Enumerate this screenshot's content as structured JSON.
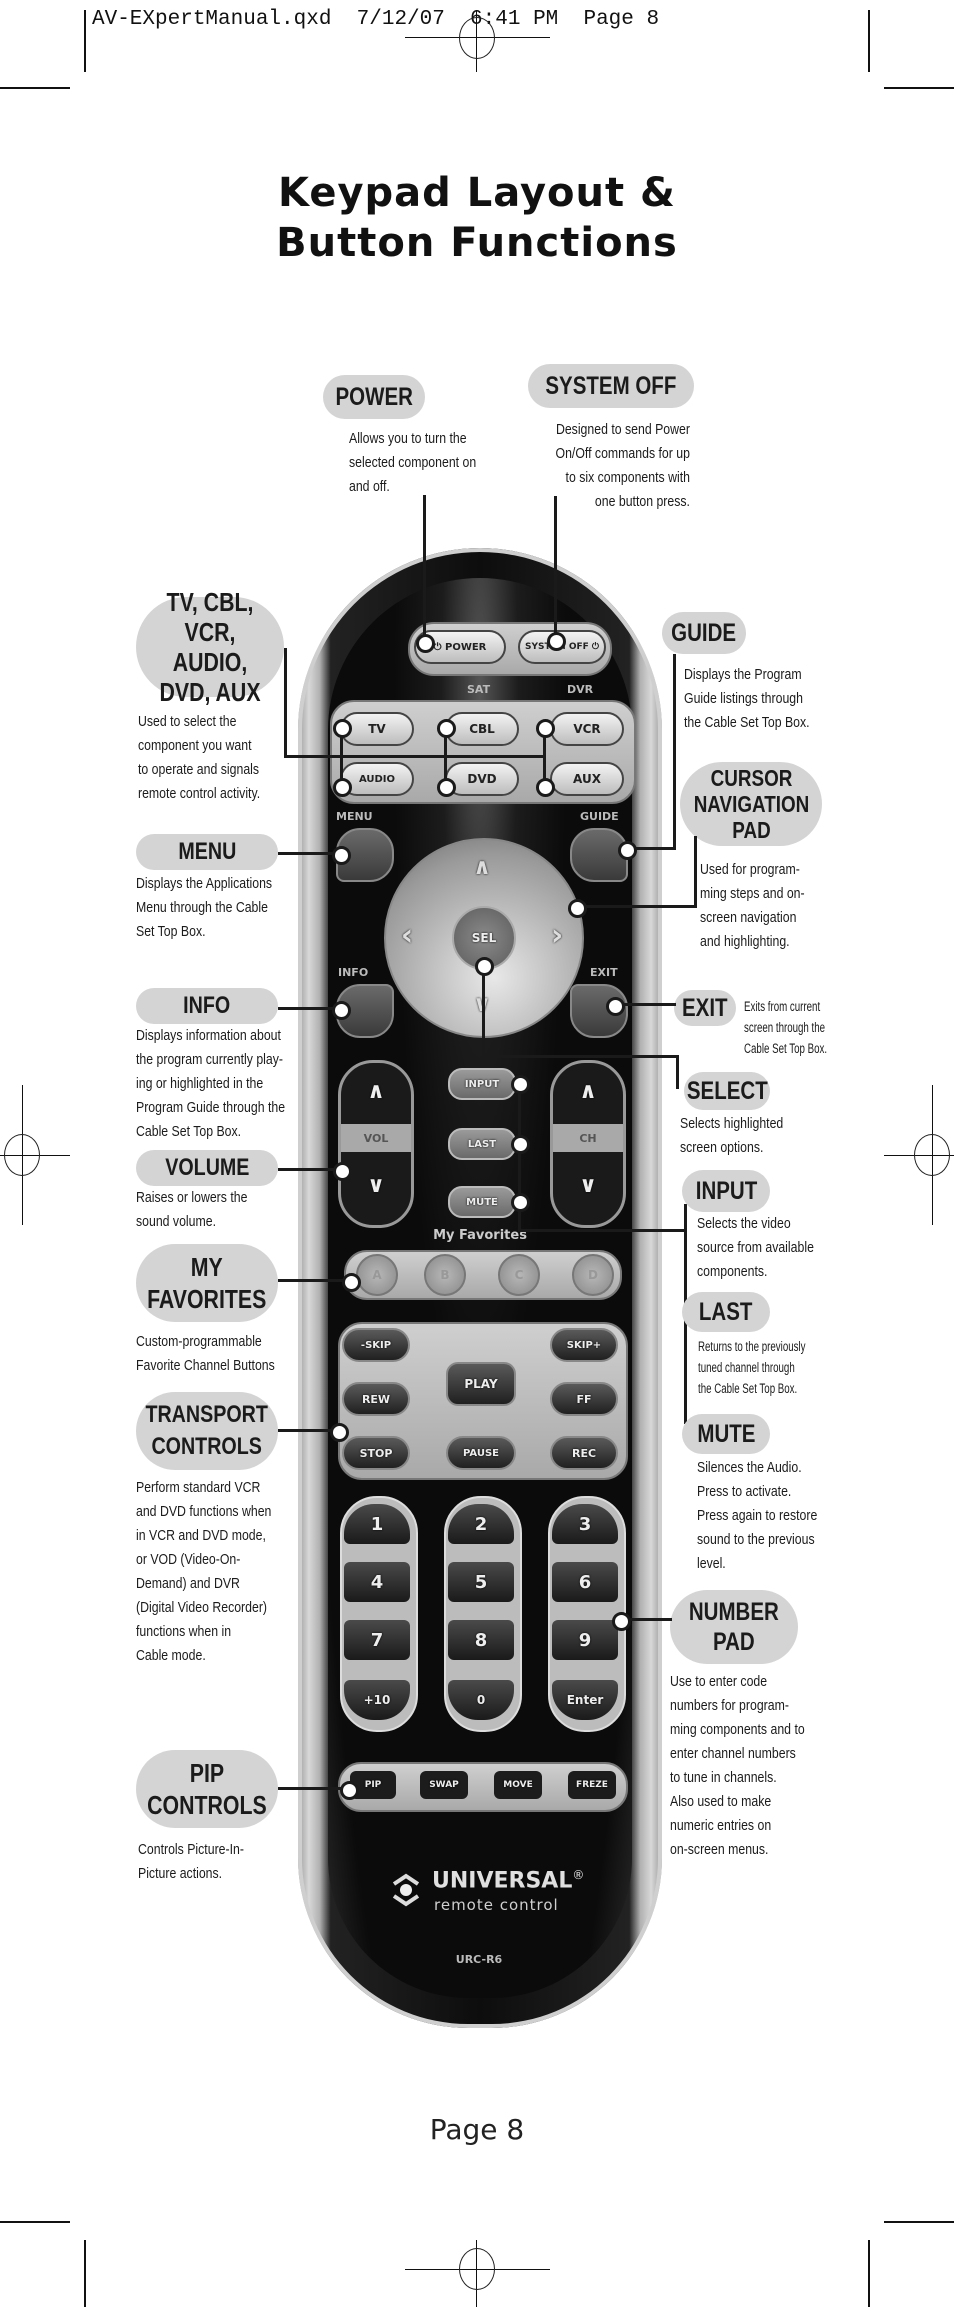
{
  "slug": "AV-EXpertManual.qxd  7/12/07  6:41 PM  Page 8",
  "title": {
    "line1": "Keypad Layout &",
    "line2": "Button Functions"
  },
  "callouts": {
    "power": {
      "label": "POWER",
      "desc": "Allows you to turn the\nselected component on\nand off."
    },
    "system_off": {
      "label": "SYSTEM OFF",
      "desc": "Designed to send Power\nOn/Off commands for up\nto six components with\none button press."
    },
    "modes": {
      "label": "TV, CBL,\nVCR, AUDIO,\nDVD, AUX",
      "desc": "Used to select the\ncomponent you want\nto operate and signals\nremote control activity."
    },
    "guide": {
      "label": "GUIDE",
      "desc": "Displays the Program\nGuide listings through\nthe Cable Set Top Box."
    },
    "cursor": {
      "label": "CURSOR\nNAVIGATION\nPAD",
      "desc": "Used for program-\nming steps and on-\nscreen navigation\nand highlighting."
    },
    "menu": {
      "label": "MENU",
      "desc": "Displays the Applications\nMenu through the Cable\nSet Top Box."
    },
    "info": {
      "label": "INFO",
      "desc": "Displays information about\nthe program currently play-\ning or highlighted in the\nProgram Guide through the\nCable Set Top Box."
    },
    "exit": {
      "label": "EXIT",
      "desc": "Exits from current\nscreen through the\nCable Set Top Box."
    },
    "select": {
      "label": "SELECT",
      "desc": "Selects highlighted\nscreen options."
    },
    "volume": {
      "label": "VOLUME",
      "desc": "Raises or lowers the\nsound volume."
    },
    "input": {
      "label": "INPUT",
      "desc": "Selects the video\nsource from available\ncomponents."
    },
    "favorites": {
      "label": "MY\nFAVORITES",
      "desc": "Custom-programmable\nFavorite Channel Buttons"
    },
    "last": {
      "label": "LAST",
      "desc": "Returns to the previously\ntuned channel through\nthe Cable Set Top Box."
    },
    "mute": {
      "label": "MUTE",
      "desc": "Silences the Audio.\nPress to activate.\nPress again to restore\nsound to the previous\nlevel."
    },
    "transport": {
      "label": "TRANSPORT\nCONTROLS",
      "desc": "Perform standard VCR\nand DVD functions when\nin VCR and DVD mode,\nor VOD (Video-On-\nDemand) and DVR\n(Digital Video Recorder)\nfunctions when in\nCable mode."
    },
    "number_pad": {
      "label": "NUMBER\nPAD",
      "desc": "Use to enter code\nnumbers for program-\nming components and to\nenter channel numbers\nto tune in channels.\nAlso used to make\nnumeric entries on\non-screen menus."
    },
    "pip": {
      "label": "PIP\nCONTROLS",
      "desc": "Controls Picture-In-\nPicture actions."
    }
  },
  "remote": {
    "power": "⏻ POWER",
    "system_off": "SYSTEM OFF ⏻",
    "sat_label": "SAT",
    "dvr_label": "DVR",
    "mode_buttons": [
      "TV",
      "CBL",
      "VCR",
      "AUDIO",
      "DVD",
      "AUX"
    ],
    "menu": "MENU",
    "guide": "GUIDE",
    "info": "INFO",
    "exit": "EXIT",
    "sel": "SEL",
    "up": "∧",
    "down": "∨",
    "left": "‹",
    "right": "›",
    "vol": "VOL",
    "ch": "CH",
    "input": "INPUT",
    "last": "LAST",
    "mute": "MUTE",
    "favorites_title": "My Favorites",
    "favorites": [
      "A",
      "B",
      "C",
      "D"
    ],
    "transport": [
      "-SKIP",
      "SKIP+",
      "PLAY",
      "REW",
      "FF",
      "STOP",
      "PAUSE",
      "REC"
    ],
    "numbers": [
      "1",
      "2",
      "3",
      "4",
      "5",
      "6",
      "7",
      "8",
      "9",
      "+10",
      "0",
      "Enter"
    ],
    "pip": [
      "PIP",
      "SWAP",
      "MOVE",
      "FREZE"
    ],
    "brand": "UNIVERSAL",
    "brand_reg": "®",
    "brand_sub": "remote control",
    "model": "URC-R6"
  },
  "page_number": "Page 8"
}
